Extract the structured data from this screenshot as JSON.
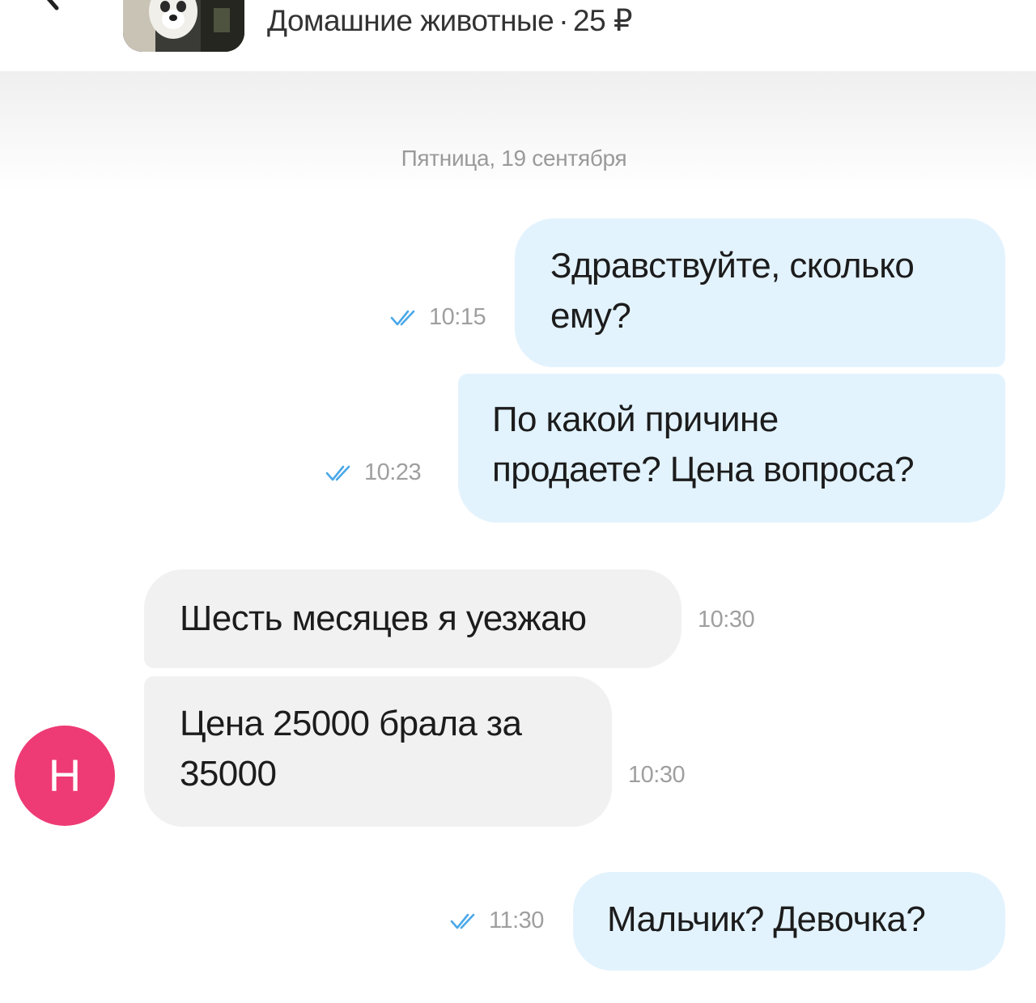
{
  "header": {
    "category": "Домашние животные",
    "separator": "·",
    "price": "25 ₽"
  },
  "chat": {
    "date_separator": "Пятница, 19 сентября",
    "messages": [
      {
        "direction": "out",
        "text_lines": [
          "Здравствуйте, сколько",
          "ему?"
        ],
        "time": "10:15",
        "status": "read"
      },
      {
        "direction": "out",
        "text_lines": [
          "По какой причине",
          "продаете? Цена вопроса?"
        ],
        "time": "10:23",
        "status": "read"
      },
      {
        "direction": "in",
        "text_lines": [
          "Шесть месяцев я  уезжаю"
        ],
        "time": "10:30"
      },
      {
        "direction": "in",
        "text_lines": [
          "Цена  25000 брала  за",
          "35000"
        ],
        "time": "10:30"
      },
      {
        "direction": "out",
        "text_lines": [
          "Мальчик? Девочка?"
        ],
        "time": "11:30",
        "status": "read"
      }
    ],
    "sender_avatar_letter": "Н"
  },
  "icons": {
    "back": "chevron-left-icon",
    "read_status": "double-check-icon"
  },
  "colors": {
    "outgoing_bubble": "#e3f3fe",
    "incoming_bubble": "#f1f1f1",
    "avatar": "#ee3b75",
    "read_check": "#4aa8e8",
    "time_text": "#9f9f9f"
  }
}
